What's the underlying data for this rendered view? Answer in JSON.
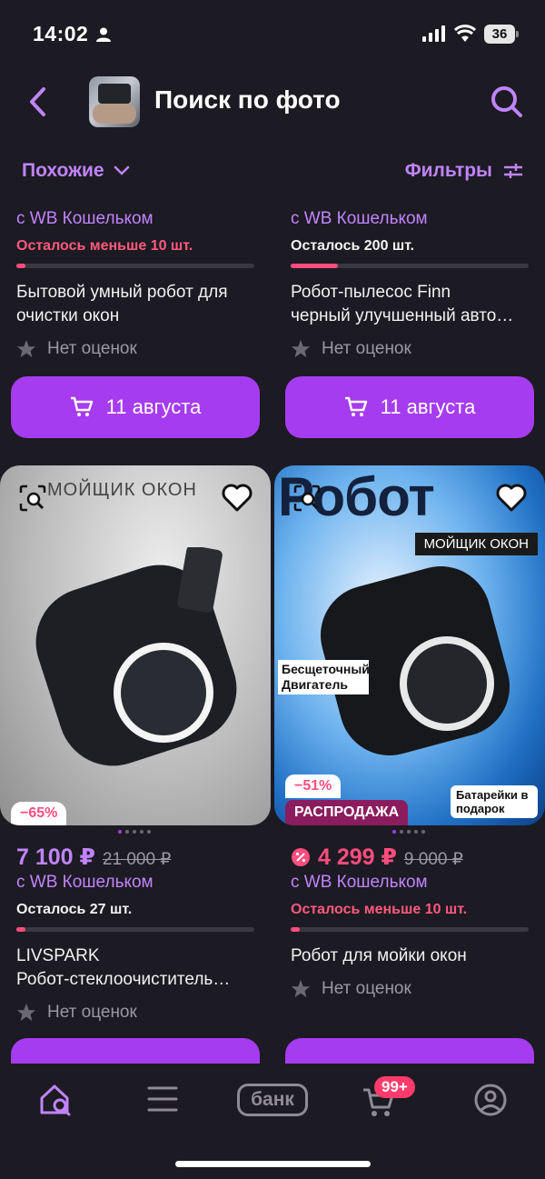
{
  "status_bar": {
    "time": "14:02",
    "battery": "36"
  },
  "header": {
    "title": "Поиск по фото"
  },
  "filter_bar": {
    "similar_label": "Похожие",
    "filters_label": "Фильтры"
  },
  "top_cards": [
    {
      "wallet": "с WB Кошельком",
      "stock": "Осталось меньше 10 шт.",
      "stock_level": 0.04,
      "name_line1": "Бытовой умный робот для",
      "name_line2": "очистки окон",
      "rating": "Нет оценок",
      "button": "11 августа"
    },
    {
      "wallet": "с WB Кошельком",
      "stock": "Осталось 200 шт.",
      "stock_level": 0.2,
      "name_line1": "Робот-пылесос Finn",
      "name_line2": "черный улучшенный авто…",
      "rating": "Нет оценок",
      "button": "11 августа"
    }
  ],
  "bottom_cards": [
    {
      "image_text": "МОЙЩИК ОКОН",
      "discount": "−65%",
      "price": "7 100 ₽",
      "old_price": "21 000 ₽",
      "wallet": "с WB Кошельком",
      "stock": "Осталось 27 шт.",
      "stock_level": 0.04,
      "brand": "LIVSPARK",
      "name": "Робот-стеклоочиститель…",
      "rating": "Нет оценок"
    },
    {
      "image_title": "Робот",
      "image_subtitle": "МОЙЩИК ОКОН",
      "image_note1": "Бесщеточный Двигатель",
      "image_note2": "Батарейки в подарок",
      "discount": "−51%",
      "sale_tag": "РАСПРОДАЖА",
      "price": "4 299 ₽",
      "old_price": "9 000 ₽",
      "wallet": "с WB Кошельком",
      "stock": "Осталось меньше 10 шт.",
      "stock_level": 0.04,
      "name": "Робот для мойки окон",
      "rating": "Нет оценок"
    }
  ],
  "tabbar": {
    "bank_label": "банк",
    "cart_badge": "99+"
  },
  "colors": {
    "accent": "#a63cf0",
    "accent_text": "#c084fc",
    "sale": "#ff4d7e",
    "background": "#1c1a22"
  }
}
